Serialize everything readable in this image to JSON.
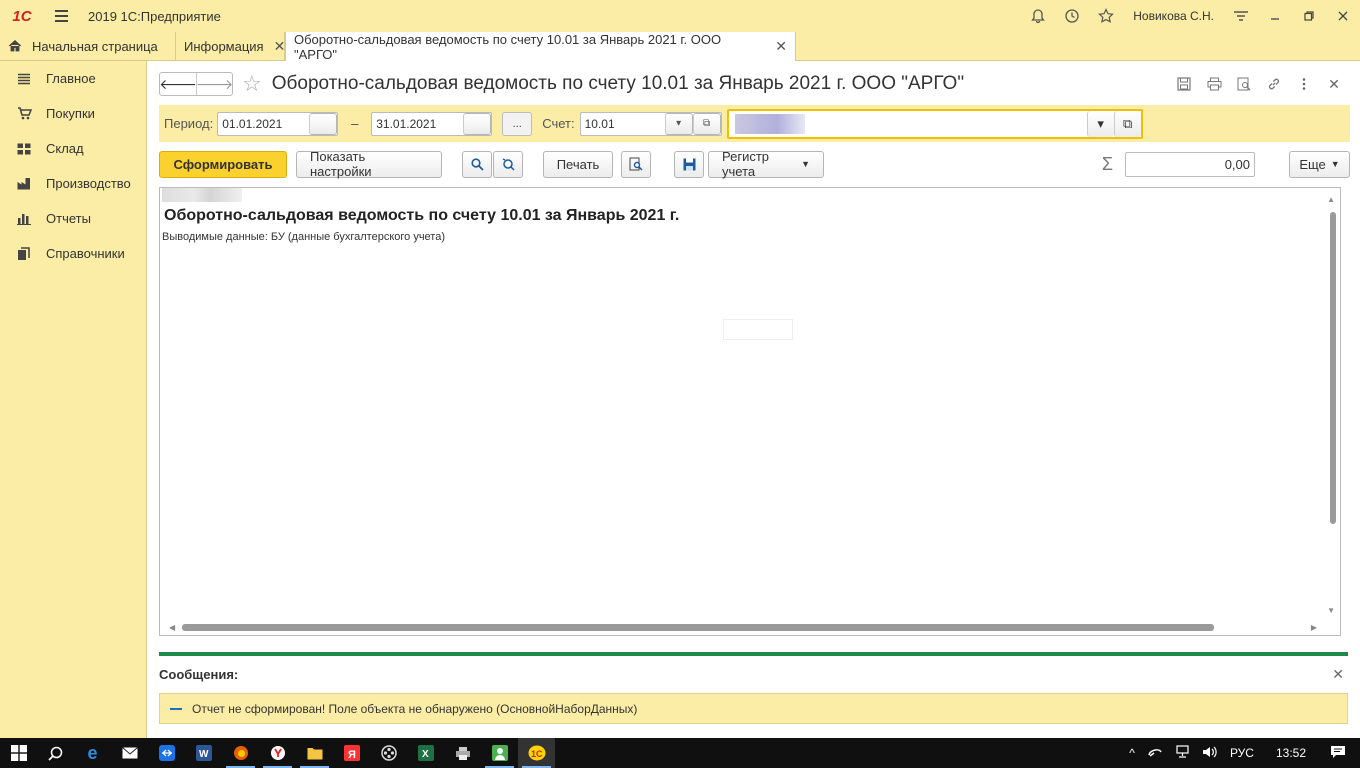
{
  "titlebar": {
    "logo": "1С",
    "app_title": "2019 1С:Предприятие",
    "user": "Новикова С.Н.",
    "icons": [
      "bell-icon",
      "history-icon",
      "star-icon",
      "settings-lines-icon",
      "minimize-icon",
      "restore-icon",
      "close-icon"
    ]
  },
  "tabs": [
    {
      "label": "Начальная страница",
      "icon": "home-icon"
    },
    {
      "label": "Информация",
      "closable": true
    },
    {
      "label": "Оборотно-сальдовая ведомость по счету 10.01 за Январь 2021 г. ООО \"АРГО\"",
      "closable": true,
      "active": true
    }
  ],
  "sidebar": {
    "items": [
      {
        "label": "Главное",
        "icon": "list-icon"
      },
      {
        "label": "Покупки",
        "icon": "cart-icon"
      },
      {
        "label": "Склад",
        "icon": "warehouse-icon"
      },
      {
        "label": "Производство",
        "icon": "factory-icon"
      },
      {
        "label": "Отчеты",
        "icon": "chart-icon"
      },
      {
        "label": "Справочники",
        "icon": "book-icon"
      }
    ]
  },
  "header": {
    "title": "Оборотно-сальдовая ведомость по счету 10.01 за Январь 2021 г. ООО \"АРГО\""
  },
  "params": {
    "period_label": "Период:",
    "date_from": "01.01.2021",
    "dash": "–",
    "date_to": "31.01.2021",
    "ellipsis": "...",
    "account_label": "Счет:",
    "account_value": "10.01"
  },
  "cmdbar": {
    "generate": "Сформировать",
    "show_settings": "Показать настройки",
    "print": "Печать",
    "register": "Регистр учета",
    "sum": "0,00",
    "more": "Еще"
  },
  "report": {
    "title": "Оборотно-сальдовая ведомость по счету 10.01 за Январь 2021 г.",
    "subtitle": "Выводимые данные:  БУ (данные бухгалтерского учета)"
  },
  "messages": {
    "header": "Сообщения:",
    "items": [
      "Отчет не сформирован! Поле объекта не обнаружено (ОсновнойНаборДанных)"
    ]
  },
  "taskbar": {
    "lang": "РУС",
    "time": "13:52"
  },
  "colors": {
    "panel": "#fbeda5",
    "primary_button": "#fbd12e",
    "messages_bar": "#1e8a4c",
    "focus_border": "#f0c000"
  }
}
